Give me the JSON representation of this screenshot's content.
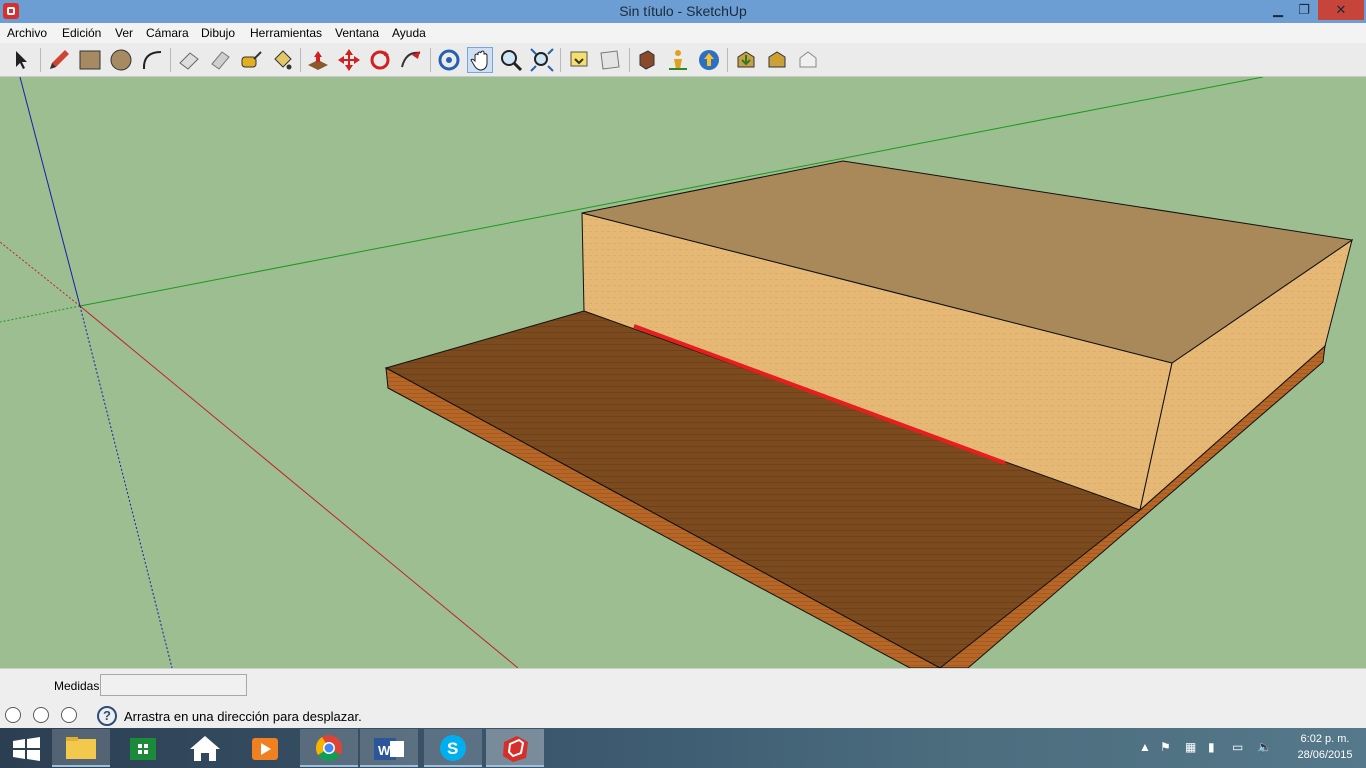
{
  "window": {
    "title": "Sin título - SketchUp"
  },
  "menu": [
    "Archivo",
    "Edición",
    "Ver",
    "Cámara",
    "Dibujo",
    "Herramientas",
    "Ventana",
    "Ayuda"
  ],
  "toolbar": {
    "tools": [
      "select-icon",
      "pencil-icon",
      "rectangle-icon",
      "circle-icon",
      "arc-icon",
      "eraser-icon",
      "paint-icon",
      "tape-measure-icon",
      "paint-bucket-icon",
      "push-pull-icon",
      "move-icon",
      "rotate-icon",
      "follow-me-icon",
      "orbit-icon",
      "pan-icon",
      "zoom-icon",
      "zoom-extents-icon",
      "previous-view-icon",
      "next-view-icon",
      "components-icon",
      "position-camera-icon",
      "walk-icon",
      "get-models-icon",
      "share-model-icon",
      "warehouse-icon"
    ],
    "active_tool": "pan-icon"
  },
  "colors": {
    "viewport_bg": "#9dbe91",
    "red_axis": "#c02323",
    "green_axis": "#1a9a1a",
    "blue_axis": "#1c1caa",
    "highlight": "#e81e1e"
  },
  "measures": {
    "label": "Medidas",
    "value": ""
  },
  "status": {
    "message": "Arrastra en una dirección para desplazar.",
    "help": "?"
  },
  "taskbar": {
    "apps": [
      "start-icon",
      "file-explorer-icon",
      "store-icon",
      "home-icon",
      "media-player-icon",
      "chrome-icon",
      "word-icon",
      "skype-icon",
      "sketchup-icon"
    ],
    "time": "6:02 p. m.",
    "date": "28/06/2015"
  }
}
